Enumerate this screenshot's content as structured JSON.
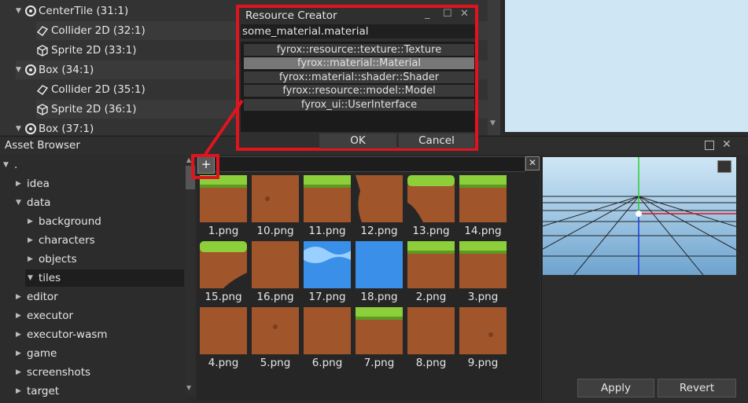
{
  "scene_tree": {
    "rows": [
      {
        "label": "CenterTile (31:1)",
        "icon": "node-icon",
        "expanded": true
      },
      {
        "label": "Collider 2D (32:1)",
        "icon": "collider-icon"
      },
      {
        "label": "Sprite 2D (33:1)",
        "icon": "sprite-icon"
      },
      {
        "label": "Box (34:1)",
        "icon": "node-icon",
        "expanded": true
      },
      {
        "label": "Collider 2D (35:1)",
        "icon": "collider-icon"
      },
      {
        "label": "Sprite 2D (36:1)",
        "icon": "sprite-icon"
      },
      {
        "label": "Box (37:1)",
        "icon": "node-icon",
        "expanded": true
      }
    ]
  },
  "asset_browser": {
    "title": "Asset Browser",
    "root": ".",
    "folders": [
      {
        "label": "idea"
      },
      {
        "label": "data",
        "expanded": true
      },
      {
        "label": "background"
      },
      {
        "label": "characters"
      },
      {
        "label": "objects"
      },
      {
        "label": "tiles",
        "selected": true,
        "expanded": true
      },
      {
        "label": "editor"
      },
      {
        "label": "executor"
      },
      {
        "label": "executor-wasm"
      },
      {
        "label": "game"
      },
      {
        "label": "screenshots"
      },
      {
        "label": "target"
      }
    ],
    "add_label": "+",
    "clear_label": "✕",
    "files": [
      "1.png",
      "10.png",
      "11.png",
      "12.png",
      "13.png",
      "14.png",
      "15.png",
      "16.png",
      "17.png",
      "18.png",
      "2.png",
      "3.png",
      "4.png",
      "5.png",
      "6.png",
      "7.png",
      "8.png",
      "9.png"
    ],
    "apply_label": "Apply",
    "revert_label": "Revert"
  },
  "dialog": {
    "title": "Resource Creator",
    "name_value": "some_material.material",
    "items": [
      "fyrox::resource::texture::Texture",
      "fyrox::material::Material",
      "fyrox::material::shader::Shader",
      "fyrox::resource::model::Model",
      "fyrox_ui::UserInterface"
    ],
    "selected_index": 1,
    "ok_label": "OK",
    "cancel_label": "Cancel",
    "min_label": "_",
    "max_label": "☐",
    "close_label": "✕"
  },
  "colors": {
    "accent_red": "#e0141e",
    "grass": "#8ccf3a",
    "dirt": "#a0552b",
    "water": "#3a8fe8"
  }
}
